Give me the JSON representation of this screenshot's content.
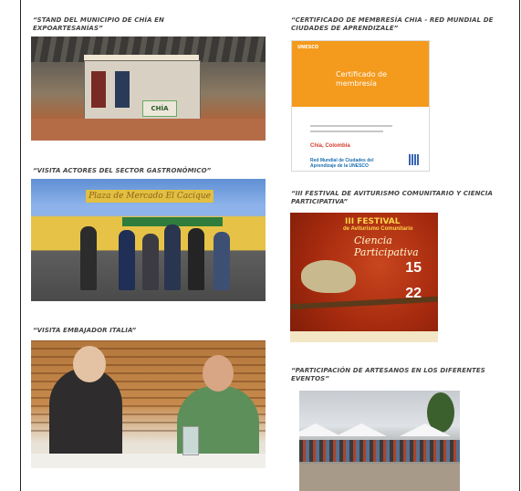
{
  "captions": {
    "stand": "“STAND DEL MUNICIPIO DE CHÍA EN EXPOARTESANÍAS”",
    "certificate": "“CERTIFICADO DE MEMBRESÍA CHIA - RED MUNDIAL DE CIUDADES DE APRENDIZALE”",
    "gastro": "“VISITA ACTORES DEL SECTOR GASTRONÓMICO”",
    "festival": "“III FESTIVAL DE AVITURISMO COMUNITARIO Y CIENCIA PARTICIPATIVA”",
    "ambassador": "“VISITA EMBAJADOR ITALIA”",
    "artisans": "“PARTICIPACIÓN DE ARTESANOS EN LOS DIFERENTES EVENTOS”"
  },
  "stand_photo": {
    "booth_sign": "CHÍA"
  },
  "certificate_doc": {
    "org": "UNESCO",
    "title": "Certificado de membresía",
    "city": "Chía, Colombia",
    "network": "Red Mundial de Ciudades del Aprendizaje de la UNESCO"
  },
  "gastro_photo": {
    "sign": "Plaza de Mercado El Cacique"
  },
  "festival_poster": {
    "edition": "III FESTIVAL",
    "subtitle": "de Aviturismo Comunitario",
    "script": "Ciencia Participativa",
    "day1": "15",
    "day2": "22"
  },
  "colors": {
    "caption": "#444444",
    "certificate_orange": "#f49a1c",
    "poster_red": "#a52a0e"
  }
}
